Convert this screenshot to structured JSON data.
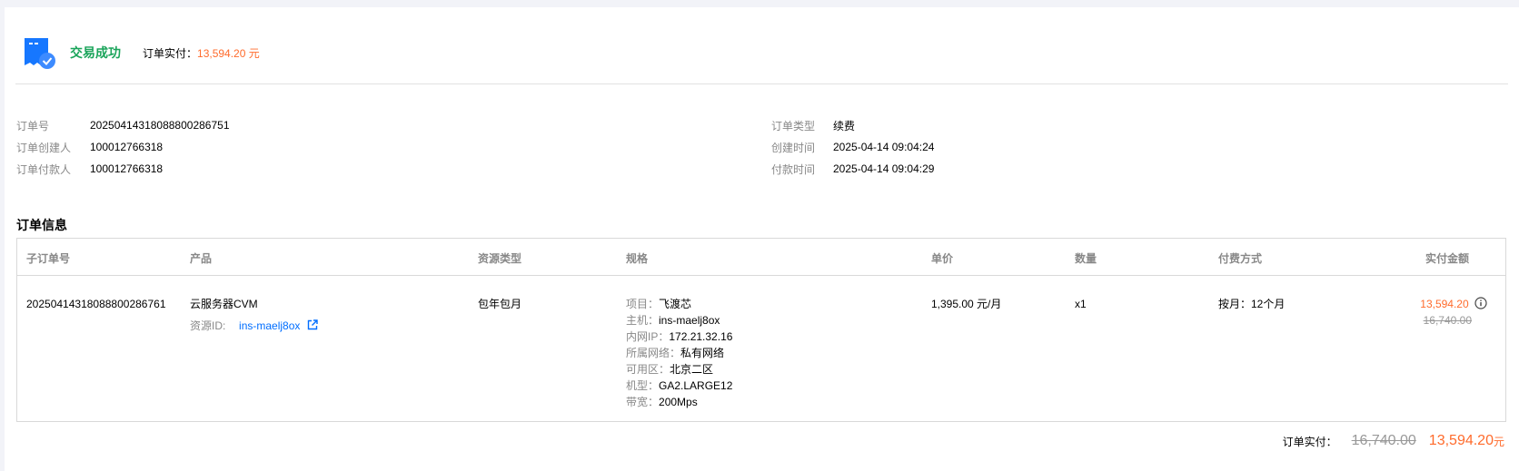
{
  "status": {
    "text": "交易成功",
    "paid_label": "订单实付：",
    "paid_amount": "13,594.20 元",
    "icon": "receipt-check-icon"
  },
  "order_info": {
    "left": [
      {
        "label": "订单号",
        "value": "20250414318088800286751"
      },
      {
        "label": "订单创建人",
        "value": "100012766318"
      },
      {
        "label": "订单付款人",
        "value": "100012766318"
      }
    ],
    "right": [
      {
        "label": "订单类型",
        "value": "续费"
      },
      {
        "label": "创建时间",
        "value": "2025-04-14 09:04:24"
      },
      {
        "label": "付款时间",
        "value": "2025-04-14 09:04:29"
      }
    ]
  },
  "section_title": "订单信息",
  "table": {
    "headers": [
      "子订单号",
      "产品",
      "资源类型",
      "规格",
      "单价",
      "数量",
      "付费方式",
      "实付金额"
    ],
    "row": {
      "sub_order_id": "20250414318088800286761",
      "product": "云服务器CVM",
      "resource_id_label": "资源ID:",
      "resource_id": "ins-maelj8ox",
      "resource_type": "包年包月",
      "specs": [
        {
          "label": "项目：",
          "value": "飞渡芯"
        },
        {
          "label": "主机：",
          "value": "ins-maelj8ox"
        },
        {
          "label": "内网IP：",
          "value": "172.21.32.16"
        },
        {
          "label": "所属网络：",
          "value": "私有网络"
        },
        {
          "label": "可用区：",
          "value": "北京二区"
        },
        {
          "label": "机型：",
          "value": "GA2.LARGE12"
        },
        {
          "label": "带宽：",
          "value": "200Mps"
        }
      ],
      "unit_price": "1,395.00 元/月",
      "quantity": "x1",
      "billing": "按月：12个月",
      "paid": "13,594.20",
      "original": "16,740.00"
    }
  },
  "footer": {
    "label": "订单实付：",
    "original": "16,740.00",
    "paid": "13,594.20",
    "unit": "元"
  },
  "colors": {
    "success": "#1aa45a",
    "price": "#ff6b2c",
    "link": "#006eff",
    "icon_blue": "#1677ff"
  }
}
